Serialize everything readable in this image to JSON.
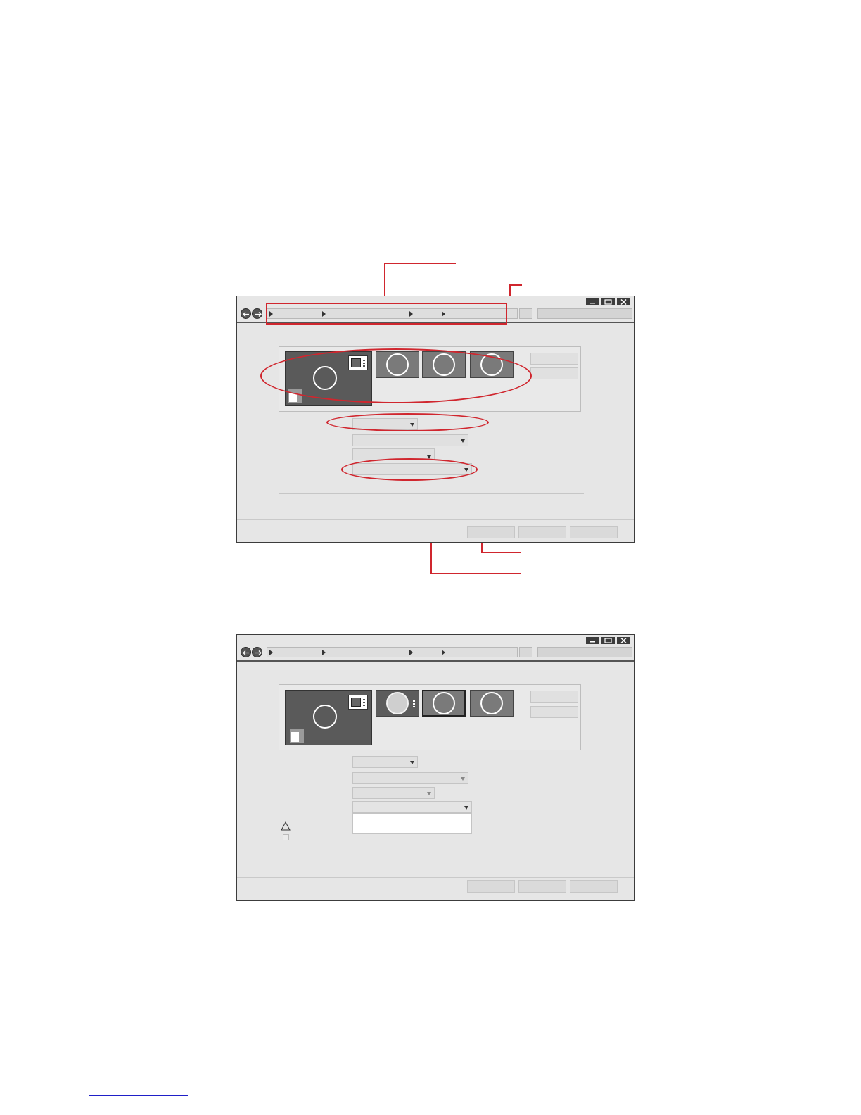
{
  "page": {
    "background": "#ffffff",
    "annotation_color": "#d0262e",
    "footer_link_color": "#1f1fc8"
  },
  "windows": [
    {
      "id": "window-annotated",
      "icons": [
        "back-arrow-icon",
        "forward-arrow-icon",
        "minimize-icon",
        "maximize-icon",
        "close-icon",
        "breadcrumb-arrow-icon",
        "dropdown-arrow-icon"
      ],
      "breadcrumb_segments": 4,
      "monitors": [
        {
          "role": "main",
          "selected": false
        },
        {
          "role": "secondary",
          "selected": false
        },
        {
          "role": "secondary",
          "selected": false
        },
        {
          "role": "secondary",
          "selected": false
        }
      ],
      "dropdowns": 4,
      "footer_buttons": 3
    },
    {
      "id": "window-expanded",
      "icons": [
        "back-arrow-icon",
        "forward-arrow-icon",
        "minimize-icon",
        "maximize-icon",
        "close-icon",
        "breadcrumb-arrow-icon",
        "dropdown-arrow-icon",
        "warning-triangle-icon",
        "checkbox-icon"
      ],
      "breadcrumb_segments": 4,
      "monitors": [
        {
          "role": "main",
          "selected": false
        },
        {
          "role": "secondary",
          "selected": false
        },
        {
          "role": "secondary",
          "selected": true
        },
        {
          "role": "secondary",
          "selected": false
        }
      ],
      "dropdowns": 4,
      "dropdown_open_index": 3,
      "footer_buttons": 3
    }
  ]
}
